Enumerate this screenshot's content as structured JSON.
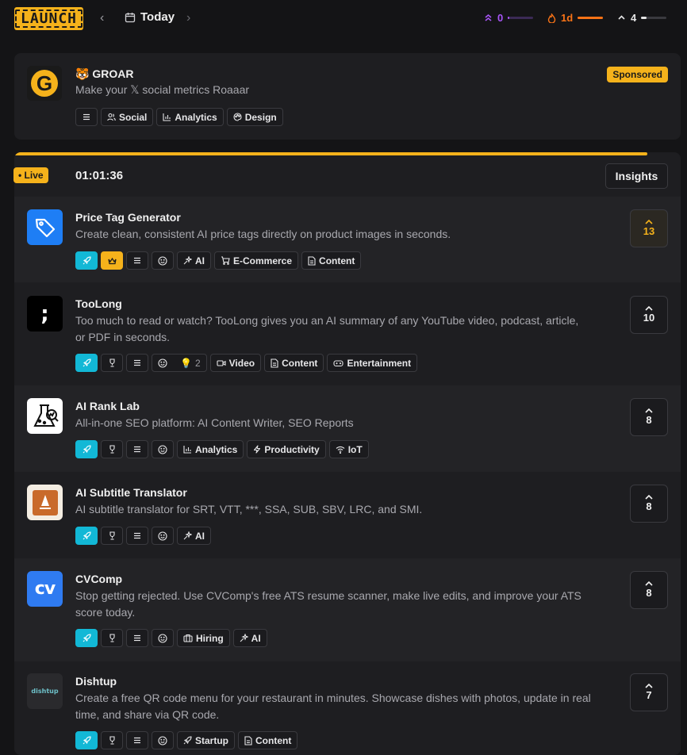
{
  "brand": {
    "logo_text": "LAUNCH"
  },
  "nav": {
    "date_label": "Today"
  },
  "stats": [
    {
      "name": "points",
      "value": "0",
      "color": "#a855f7",
      "progress": 0.06
    },
    {
      "name": "streak",
      "value": "1d",
      "color": "#f97316",
      "progress": 1.0
    },
    {
      "name": "votes",
      "value": "4",
      "color": "#e5e5e5",
      "progress": 0.2
    }
  ],
  "sponsor": {
    "emoji": "🐯",
    "name": "GROAR",
    "tagline": "Make your 𝕏 social metrics Roaaar",
    "badge": "Sponsored",
    "tags": [
      "Social",
      "Analytics",
      "Design"
    ]
  },
  "live": {
    "badge": "• Live",
    "timer": "01:01:36",
    "insights_label": "Insights",
    "progress": 0.95
  },
  "products": [
    {
      "name": "Price Tag Generator",
      "desc": "Create clean, consistent AI price tags directly on product images in seconds.",
      "votes": "13",
      "tags": [
        "AI",
        "E-Commerce",
        "Content"
      ],
      "logo": "tag-icon"
    },
    {
      "name": "TooLong",
      "desc": "Too much to read or watch? TooLong gives you an AI summary of any YouTube video, podcast, article, or PDF in seconds.",
      "votes": "10",
      "tags": [
        "Video",
        "Content",
        "Entertainment"
      ],
      "ideas": "2",
      "logo": "semicolon-icon"
    },
    {
      "name": "AI Rank Lab",
      "desc": "All-in-one SEO platform: AI Content Writer, SEO Reports",
      "votes": "8",
      "tags": [
        "Analytics",
        "Productivity",
        "IoT"
      ],
      "logo": "flask-icon"
    },
    {
      "name": "AI Subtitle Translator",
      "desc": "AI subtitle translator for SRT, VTT, ***, SSA, SUB, SBV, LRC, and SMI.",
      "votes": "8",
      "tags": [
        "AI"
      ],
      "logo": "subtitle-icon"
    },
    {
      "name": "CVComp",
      "desc": "Stop getting rejected. Use CVComp's free ATS resume scanner, make live edits, and improve your ATS score today.",
      "votes": "8",
      "tags": [
        "Hiring",
        "AI"
      ],
      "logo": "cv-icon"
    },
    {
      "name": "Dishtup",
      "desc": "Create a free QR code menu for your restaurant in minutes. Showcase dishes with photos, update in real time, and share via QR code.",
      "votes": "7",
      "tags": [
        "Startup",
        "Content"
      ],
      "logo": "dishtup-logo"
    }
  ]
}
